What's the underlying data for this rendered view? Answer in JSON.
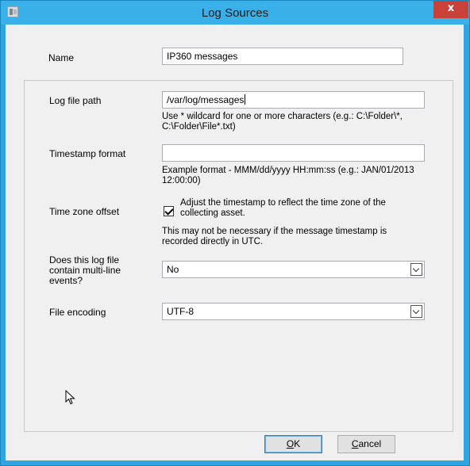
{
  "window": {
    "title": "Log Sources",
    "close_label": "x"
  },
  "name_field": {
    "label": "Name",
    "value": "IP360 messages"
  },
  "log_file_path": {
    "label": "Log file path",
    "value": "/var/log/messages",
    "hint_line1": "Use * wildcard for one or more characters (e.g.: C:\\Folder\\*,",
    "hint_line2": "C:\\Folder\\File*.txt)"
  },
  "timestamp_format": {
    "label": "Timestamp format",
    "value": "",
    "hint_line1": "Example format - MMM/dd/yyyy HH:mm:ss (e.g.: JAN/01/2013",
    "hint_line2": "12:00:00)"
  },
  "time_zone": {
    "label": "Time zone offset",
    "checked": true,
    "checkbox_line1": "Adjust the timestamp to reflect the time zone of the",
    "checkbox_line2": "collecting asset.",
    "note_line1": "This may not be necessary if the message timestamp is",
    "note_line2": "recorded directly in UTC."
  },
  "multiline": {
    "label_line1": "Does this log file",
    "label_line2": "contain multi-line",
    "label_line3": "events?",
    "selected": "No"
  },
  "encoding": {
    "label": "File encoding",
    "selected": "UTF-8"
  },
  "buttons": {
    "ok_mnemonic": "O",
    "ok_rest": "K",
    "cancel_mnemonic": "C",
    "cancel_rest": "ancel"
  }
}
